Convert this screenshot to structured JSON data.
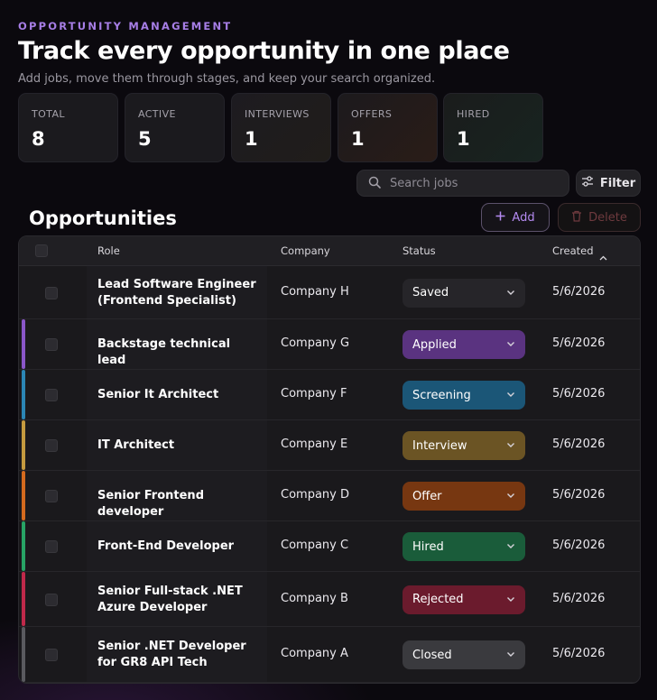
{
  "header": {
    "eyebrow": "OPPORTUNITY MANAGEMENT",
    "title": "Track every opportunity in one place",
    "subtitle": "Add jobs, move them through stages, and keep your search organized."
  },
  "stats": [
    {
      "label": "TOTAL",
      "value": "8"
    },
    {
      "label": "ACTIVE",
      "value": "5"
    },
    {
      "label": "INTERVIEWS",
      "value": "1"
    },
    {
      "label": "OFFERS",
      "value": "1"
    },
    {
      "label": "HIRED",
      "value": "1"
    }
  ],
  "toolbar": {
    "search_placeholder": "Search jobs",
    "filter_label": "Filter",
    "add_label": "Add",
    "delete_label": "Delete",
    "search_icon": "search-icon",
    "filter_icon": "sliders-icon"
  },
  "section_title": "Opportunities",
  "table": {
    "columns": {
      "role": "Role",
      "company": "Company",
      "status": "Status",
      "created": "Created"
    },
    "sort": {
      "column": "Created",
      "direction": "ascending"
    },
    "rows": [
      {
        "role": "Lead Software Engineer (Frontend Specialist)",
        "company": "Company H",
        "status": "Saved",
        "created": "5/6/2026",
        "status_color": "#262529",
        "accent": ""
      },
      {
        "role": "Backstage technical lead",
        "company": "Company G",
        "status": "Applied",
        "created": "5/6/2026",
        "status_color": "#5a3380",
        "accent": "#8a56c9"
      },
      {
        "role": "Senior It Architect",
        "company": "Company F",
        "status": "Screening",
        "created": "5/6/2026",
        "status_color": "#1b5677",
        "accent": "#2b86b5"
      },
      {
        "role": "IT Architect",
        "company": "Company E",
        "status": "Interview",
        "created": "5/6/2026",
        "status_color": "#6b5424",
        "accent": "#c59a3f"
      },
      {
        "role": "Senior Frontend developer",
        "company": "Company D",
        "status": "Offer",
        "created": "5/6/2026",
        "status_color": "#773711",
        "accent": "#d46a1e"
      },
      {
        "role": "Front-End Developer",
        "company": "Company C",
        "status": "Hired",
        "created": "5/6/2026",
        "status_color": "#1a5c3a",
        "accent": "#27a465"
      },
      {
        "role": "Senior Full-stack .NET Azure Developer",
        "company": "Company B",
        "status": "Rejected",
        "created": "5/6/2026",
        "status_color": "#6b1b2d",
        "accent": "#c0294a"
      },
      {
        "role": "Senior .NET Developer for GR8 API Tech",
        "company": "Company A",
        "status": "Closed",
        "created": "5/6/2026",
        "status_color": "#3a3a3e",
        "accent": "#5a5a5f"
      }
    ]
  }
}
